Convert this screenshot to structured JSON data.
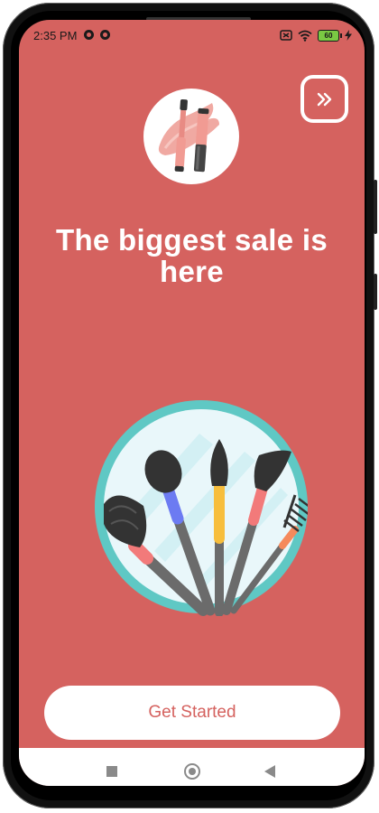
{
  "status_bar": {
    "time": "2:35 PM",
    "battery_level": "60",
    "icons": [
      "notification-icon",
      "notification-icon",
      "no-sim-icon",
      "wifi-icon",
      "battery-icon",
      "charging-icon"
    ]
  },
  "onboarding": {
    "skip_icon": "double-chevron-right-icon",
    "product_image": "lipstick-icon",
    "headline": "The biggest sale is here",
    "illustration": "makeup-brushes-illustration",
    "cta_label": "Get Started"
  },
  "nav_bar": {
    "recents_icon": "recents-icon",
    "home_icon": "home-icon",
    "back_icon": "back-icon"
  },
  "colors": {
    "background": "#d5625f",
    "cta_text": "#d5625f",
    "cta_background": "#ffffff",
    "headline": "#ffffff",
    "mirror_ring": "#5fc8c4"
  }
}
